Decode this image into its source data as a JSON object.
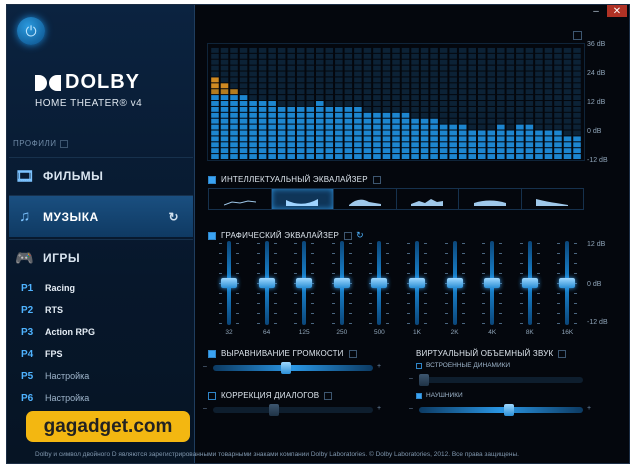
{
  "window": {
    "minimize": "–",
    "close": "✕"
  },
  "brand": {
    "word": "DOLBY",
    "sub": "HOME THEATER® v4"
  },
  "sidebar": {
    "profiles_label": "ПРОФИЛИ",
    "categories": [
      {
        "label": "ФИЛЬМЫ",
        "icon": "film-icon"
      },
      {
        "label": "МУЗЫКА",
        "icon": "music-note-icon",
        "active": true
      },
      {
        "label": "ИГРЫ",
        "icon": "gamepad-icon"
      }
    ],
    "presets": [
      {
        "num": "P1",
        "label": "Racing"
      },
      {
        "num": "P2",
        "label": "RTS"
      },
      {
        "num": "P3",
        "label": "Action RPG"
      },
      {
        "num": "P4",
        "label": "FPS"
      },
      {
        "num": "P5",
        "label": "Настройка"
      },
      {
        "num": "P6",
        "label": "Настройка"
      }
    ]
  },
  "visualizer": {
    "db_labels": [
      "36 dB",
      "24 dB",
      "12 dB",
      "0 dB",
      "-12 dB"
    ],
    "levels": [
      0.72,
      0.68,
      0.62,
      0.58,
      0.55,
      0.55,
      0.52,
      0.5,
      0.5,
      0.48,
      0.47,
      0.52,
      0.5,
      0.5,
      0.47,
      0.47,
      0.45,
      0.45,
      0.42,
      0.45,
      0.42,
      0.4,
      0.38,
      0.38,
      0.35,
      0.35,
      0.32,
      0.3,
      0.28,
      0.3,
      0.32,
      0.3,
      0.32,
      0.35,
      0.3,
      0.28,
      0.3,
      0.25,
      0.22
    ]
  },
  "intelligent_eq": {
    "label": "ИНТЕЛЛЕКТУАЛЬНЫЙ ЭКВАЛАЙЗЕР",
    "enabled": true,
    "selected_index": 1,
    "presets": [
      "eq-preset-1",
      "eq-preset-2",
      "eq-preset-3",
      "eq-preset-4",
      "eq-preset-5",
      "eq-preset-6"
    ]
  },
  "graphic_eq": {
    "label": "ГРАФИЧЕСКИЙ ЭКВАЛАЙЗЕР",
    "enabled": true,
    "db_labels": [
      "12 dB",
      "0 dB",
      "-12 dB"
    ],
    "bands": [
      {
        "freq": "32",
        "gain_db": 0
      },
      {
        "freq": "64",
        "gain_db": 0
      },
      {
        "freq": "125",
        "gain_db": 0
      },
      {
        "freq": "250",
        "gain_db": 0
      },
      {
        "freq": "500",
        "gain_db": 0
      },
      {
        "freq": "1K",
        "gain_db": 0
      },
      {
        "freq": "2K",
        "gain_db": 0
      },
      {
        "freq": "4K",
        "gain_db": 0
      },
      {
        "freq": "8K",
        "gain_db": 0
      },
      {
        "freq": "16K",
        "gain_db": 0
      }
    ]
  },
  "volume_leveler": {
    "label": "ВЫРАВНИВАНИЕ ГРОМКОСТИ",
    "enabled": true,
    "value": 0.45
  },
  "dialog_enhancer": {
    "label": "КОРРЕКЦИЯ ДИАЛОГОВ",
    "enabled": false,
    "value": 0.37
  },
  "surround": {
    "label": "ВИРТУАЛЬНЫЙ ОБЪЕМНЫЙ ЗВУК",
    "speakers": {
      "label": "ВСТРОЕННЫЕ ДИНАМИКИ",
      "enabled": false,
      "value": 0.0
    },
    "headphones": {
      "label": "НАУШНИКИ",
      "enabled": true,
      "value": 0.55
    }
  },
  "slider_minus": "–",
  "slider_plus": "+",
  "footer": "Dolby и символ двойного D являются зарегистрированными товарными знаками компании Dolby Laboratories. © Dolby Laboratories, 2012. Все права защищены.",
  "watermark": {
    "text": "gagadget.com",
    "tld": ""
  }
}
